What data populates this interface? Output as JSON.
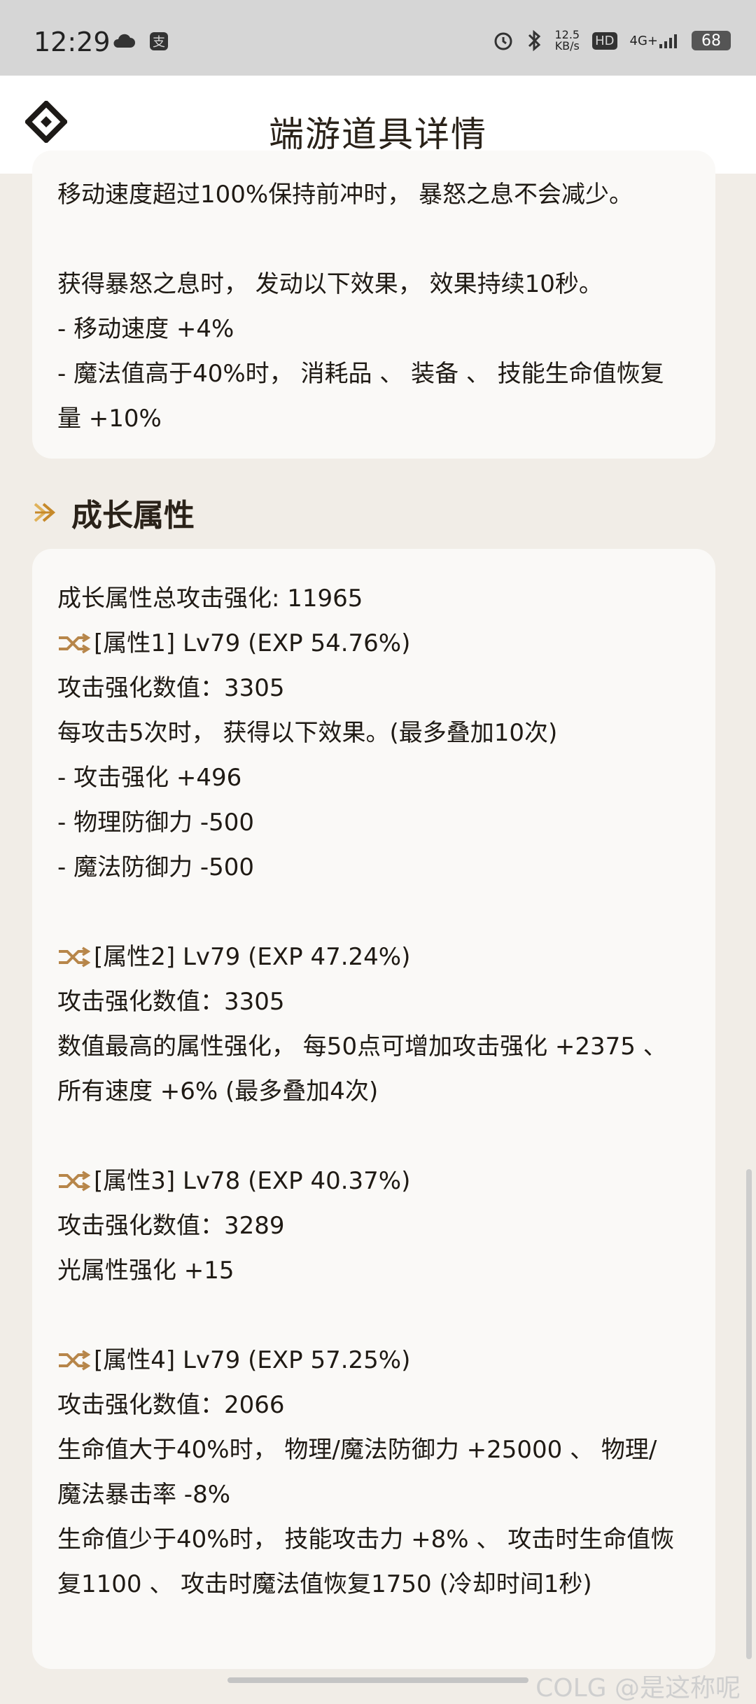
{
  "status_bar": {
    "time": "12:29",
    "net_speed": "12.5",
    "net_unit": "KB/s",
    "hd": "HD",
    "signal": "4G+",
    "battery": "68"
  },
  "header": {
    "title": "端游道具详情"
  },
  "card1": {
    "lines": [
      "移动速度超过100%保持前冲时， 暴怒之息不会减少。",
      "获得暴怒之息时， 发动以下效果， 效果持续10秒。",
      "- 移动速度 +4%",
      "- 魔法值高于40%时， 消耗品 、 装备 、 技能生命值恢复",
      "量 +10%"
    ]
  },
  "section": {
    "title": "成长属性"
  },
  "card2": {
    "total": "成长属性总攻击强化: 11965",
    "attr1": {
      "head": "[属性1] Lv79 (EXP 54.76%)",
      "value": "攻击强化数值：3305",
      "desc": "每攻击5次时， 获得以下效果。(最多叠加10次)",
      "e1": "- 攻击强化 +496",
      "e2": "- 物理防御力 -500",
      "e3": "- 魔法防御力 -500"
    },
    "attr2": {
      "head": "[属性2] Lv79 (EXP 47.24%)",
      "value": "攻击强化数值：3305",
      "d1": "数值最高的属性强化， 每50点可增加攻击强化 +2375 、",
      "d2": "所有速度 +6% (最多叠加4次)"
    },
    "attr3": {
      "head": "[属性3] Lv78 (EXP 40.37%)",
      "value": "攻击强化数值：3289",
      "d1": "光属性强化 +15"
    },
    "attr4": {
      "head": "[属性4] Lv79 (EXP 57.25%)",
      "value": "攻击强化数值：2066",
      "d1": "生命值大于40%时， 物理/魔法防御力 +25000 、 物理/",
      "d2": "魔法暴击率 -8%",
      "d3": "生命值少于40%时， 技能攻击力 +8% 、 攻击时生命值恢",
      "d4": "复1100 、 攻击时魔法值恢复1750 (冷却时间1秒)"
    }
  },
  "watermark": "COLG @是这称呢"
}
